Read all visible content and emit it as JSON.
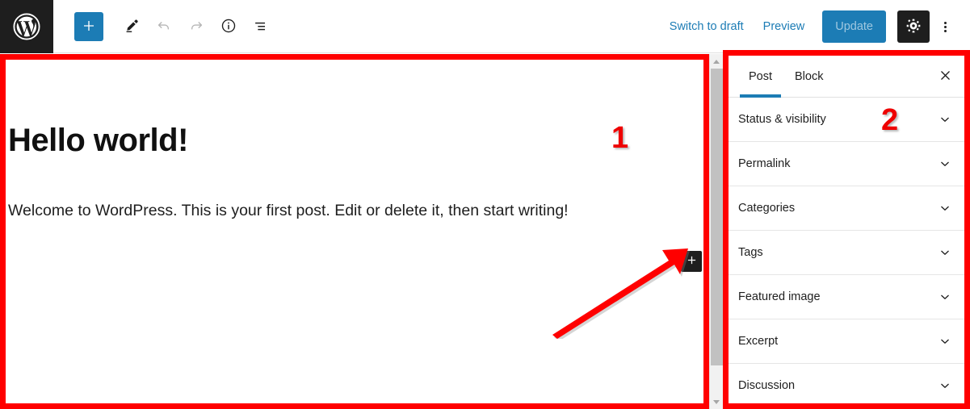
{
  "toolbar": {
    "logo_icon": "wordpress-logo-icon",
    "inserter_label": "+",
    "inserter_icon": "plus-icon",
    "tools_icon": "pencil-edit-icon",
    "undo_icon": "undo-icon",
    "redo_icon": "redo-icon",
    "details_icon": "info-icon",
    "list_view_icon": "list-view-icon",
    "switch_to_draft_label": "Switch to draft",
    "preview_label": "Preview",
    "update_label": "Update",
    "settings_icon": "gear-icon",
    "options_icon": "kebab-menu-icon",
    "accent_blue": "#1c7cb5",
    "dark": "#1e1e1e"
  },
  "editor": {
    "post_title": "Hello world!",
    "post_paragraph": "Welcome to WordPress. This is your first post. Edit or delete it, then start writing!",
    "block_appender_icon": "plus-icon"
  },
  "scrollbar": {
    "up_arrow_icon": "triangle-up-icon",
    "down_arrow_icon": "triangle-down-icon"
  },
  "sidebar": {
    "tabs": [
      {
        "label": "Post",
        "active": true
      },
      {
        "label": "Block",
        "active": false
      }
    ],
    "close_icon": "close-icon",
    "panels": [
      {
        "label": "Status & visibility",
        "chevron": "chevron-down-icon"
      },
      {
        "label": "Permalink",
        "chevron": "chevron-down-icon"
      },
      {
        "label": "Categories",
        "chevron": "chevron-down-icon"
      },
      {
        "label": "Tags",
        "chevron": "chevron-down-icon"
      },
      {
        "label": "Featured image",
        "chevron": "chevron-down-icon"
      },
      {
        "label": "Excerpt",
        "chevron": "chevron-down-icon"
      },
      {
        "label": "Discussion",
        "chevron": "chevron-down-icon"
      }
    ]
  },
  "annotations": {
    "badge_1": "1",
    "badge_2": "2",
    "arrow_icon": "red-arrow-icon",
    "color": "#ff0000"
  }
}
